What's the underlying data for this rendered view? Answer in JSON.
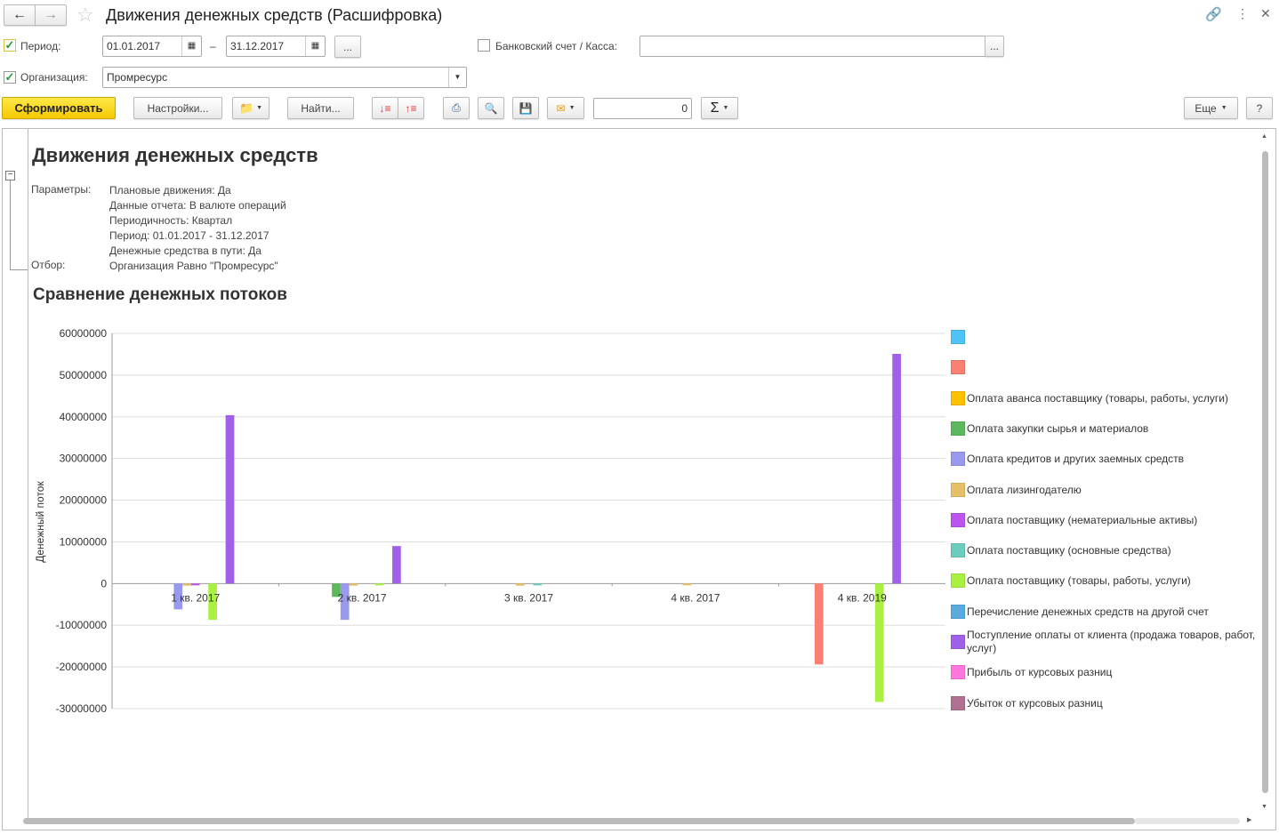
{
  "window": {
    "title": "Движения денежных средств (Расшифровка)"
  },
  "filters": {
    "period_label": "Период:",
    "period_from": "01.01.2017",
    "period_dash": "–",
    "period_to": "31.12.2017",
    "period_more": "...",
    "bank_label": "Банковский счет / Касса:",
    "bank_value": "",
    "bank_more": "...",
    "org_label": "Организация:",
    "org_value": "Промресурс",
    "period_checked": true,
    "org_checked": true,
    "bank_checked": false
  },
  "toolbar": {
    "generate": "Сформировать",
    "settings": "Настройки...",
    "find": "Найти...",
    "sum_value": "0",
    "more": "Еще",
    "help": "?"
  },
  "report": {
    "title": "Движения денежных средств",
    "params_label": "Параметры:",
    "params": [
      "Плановые движения: Да",
      "Данные отчета: В валюте операций",
      "Периодичность: Квартал",
      "Период: 01.01.2017 - 31.12.2017",
      "Денежные средства в пути: Да"
    ],
    "filter_label": "Отбор:",
    "filter_value": "Организация Равно \"Промресурс\"",
    "chart_title": "Сравнение денежных потоков"
  },
  "chart_data": {
    "type": "bar",
    "title": "Сравнение денежных потоков",
    "ylabel": "Денежный поток",
    "xlabel": "",
    "ylim": [
      -30000000,
      60000000
    ],
    "yticks": [
      60000000,
      50000000,
      40000000,
      30000000,
      20000000,
      10000000,
      0,
      -10000000,
      -20000000,
      -30000000
    ],
    "grid": true,
    "legend": "right",
    "categories": [
      "1 кв. 2017",
      "2 кв. 2017",
      "3 кв. 2017",
      "4 кв. 2017",
      "4 кв. 2019"
    ],
    "series": [
      {
        "name": "",
        "color": "#4fc3f7",
        "values": [
          0,
          0,
          0,
          0,
          0
        ]
      },
      {
        "name": "",
        "color": "#fa8072",
        "values": [
          0,
          0,
          0,
          0,
          -19400000
        ]
      },
      {
        "name": "Оплата аванса поставщику (товары, работы, услуги)",
        "color": "#ffc000",
        "values": [
          0,
          0,
          0,
          0,
          0
        ]
      },
      {
        "name": "Оплата закупки сырья и материалов",
        "color": "#5cb85c",
        "values": [
          0,
          -3200000,
          0,
          0,
          0
        ]
      },
      {
        "name": "Оплата кредитов и других заемных средств",
        "color": "#9999ee",
        "values": [
          -6200000,
          -8700000,
          0,
          0,
          0
        ]
      },
      {
        "name": "Оплата лизингодателю",
        "color": "#e6c068",
        "values": [
          -500000,
          -500000,
          -500000,
          -300000,
          0
        ]
      },
      {
        "name": "Оплата поставщику (нематериальные активы)",
        "color": "#bb55ee",
        "values": [
          -200000,
          0,
          0,
          0,
          0
        ]
      },
      {
        "name": "Оплата поставщику (основные средства)",
        "color": "#6cccc0",
        "values": [
          0,
          0,
          -400000,
          0,
          0
        ]
      },
      {
        "name": "Оплата поставщику (товары, работы, услуги)",
        "color": "#aaf040",
        "values": [
          -8700000,
          -200000,
          0,
          0,
          -28400000
        ]
      },
      {
        "name": "Перечисление денежных средств на другой счет",
        "color": "#5aacdf",
        "values": [
          0,
          0,
          0,
          0,
          0
        ]
      },
      {
        "name": "Поступление оплаты от клиента (продажа товаров, работ, услуг)",
        "color": "#a060e8",
        "values": [
          40400000,
          9000000,
          0,
          0,
          55100000
        ]
      },
      {
        "name": "Прибыль от курсовых разниц",
        "color": "#ff77dd",
        "values": [
          0,
          0,
          0,
          0,
          0
        ]
      },
      {
        "name": "Убыток от курсовых разниц",
        "color": "#b07090",
        "values": [
          0,
          0,
          0,
          0,
          0
        ]
      }
    ]
  }
}
